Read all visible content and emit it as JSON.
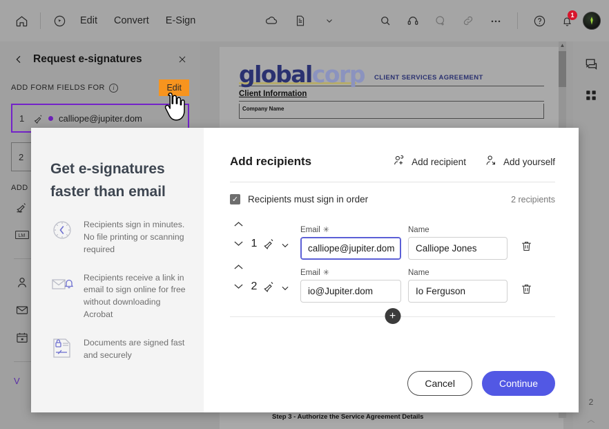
{
  "toolbar": {
    "home_icon": "home-icon",
    "select_icon": "select-tool-icon",
    "menus": [
      "Edit",
      "Convert",
      "E-Sign"
    ],
    "cloud_icon": "cloud-icon",
    "document_icon": "document-icon",
    "chevron_icon": "chevron-down-icon",
    "search_icon": "search-icon",
    "headset_icon": "headset-icon",
    "add_person_icon": "add-person-icon",
    "link_icon": "link-icon",
    "more_icon": "more-options-icon",
    "help_icon": "help-icon",
    "bell_icon": "notification-bell-icon",
    "bell_badge": "1",
    "avatar_icon": "user-avatar"
  },
  "left_panel": {
    "back_icon": "back-chevron-icon",
    "title": "Request e-signatures",
    "close_icon": "close-icon",
    "section_label": "ADD FORM FIELDS FOR",
    "info_icon": "info-icon",
    "info_glyph": "i",
    "edit_label": "Edit",
    "recipients": [
      {
        "num": "1",
        "email": "calliope@jupiter.dom",
        "pen_icon": "signature-pen-icon",
        "selected": true
      },
      {
        "num": "2",
        "email": "",
        "pen_icon": "signature-pen-icon",
        "selected": false
      }
    ],
    "section2_label": "ADD",
    "tools": [
      "signature-field-icon",
      "initials-field-icon",
      "name-field-icon",
      "email-field-icon",
      "date-field-icon"
    ],
    "more_label": "V"
  },
  "document": {
    "logo_part1": "global",
    "logo_part2": "corp",
    "logo_tagline": "CLIENT SERVICES AGREEMENT",
    "heading": "Client Information",
    "cell_label": "Company Name",
    "footer": "Step 3 - Authorize the Service Agreement Details",
    "page_number": "2",
    "scroll_up_icon": "scroll-up-arrow",
    "chevron_up_icon": "chevron-up-icon"
  },
  "right_rail": {
    "comment_icon": "comment-icon",
    "thumbnail_icon": "page-thumbnails-icon"
  },
  "modal": {
    "promo": {
      "title_line1": "Get e-signatures",
      "title_line2": "faster than email",
      "items": [
        {
          "icon": "clock-icon",
          "text": "Recipients sign in minutes. No file printing or scanning required"
        },
        {
          "icon": "email-notification-icon",
          "text": "Recipients receive a link in email to sign online for free without downloading Acrobat"
        },
        {
          "icon": "secure-document-icon",
          "text": "Documents are signed fast and securely"
        }
      ]
    },
    "title": "Add recipients",
    "add_recipient_label": "Add recipient",
    "add_recipient_icon": "add-recipient-icon",
    "add_yourself_label": "Add yourself",
    "add_yourself_icon": "add-yourself-icon",
    "sign_in_order_label": "Recipients must sign in order",
    "sign_in_order_checked": true,
    "checkmark": "✓",
    "recipient_count": "2 recipients",
    "email_label": "Email",
    "name_label": "Name",
    "required_marker": "✳",
    "rows": [
      {
        "num": "1",
        "pen_icon": "signature-pen-icon",
        "chevron_icon": "chevron-down-icon",
        "email": "calliope@jupiter.dom",
        "name": "Calliope Jones",
        "email_focused": true,
        "up_icon": "move-up-icon",
        "down_icon": "move-down-icon",
        "delete_icon": "delete-icon"
      },
      {
        "num": "2",
        "pen_icon": "signature-pen-icon",
        "chevron_icon": "chevron-down-icon",
        "email": "io@Jupiter.dom",
        "name": "Io Ferguson",
        "email_focused": false,
        "up_icon": "move-up-icon",
        "down_icon": "move-down-icon",
        "delete_icon": "delete-icon"
      }
    ],
    "add_row_icon": "add-row-plus-icon",
    "add_row_glyph": "+",
    "cancel_label": "Cancel",
    "continue_label": "Continue"
  },
  "colors": {
    "accent_blue": "#5258e4",
    "highlight_orange": "#f7941e",
    "selection_purple": "#7322c9",
    "badge_red": "#d7162c",
    "logo_navy": "#2a3170"
  },
  "cursor": {
    "icon": "pointing-hand-cursor"
  }
}
